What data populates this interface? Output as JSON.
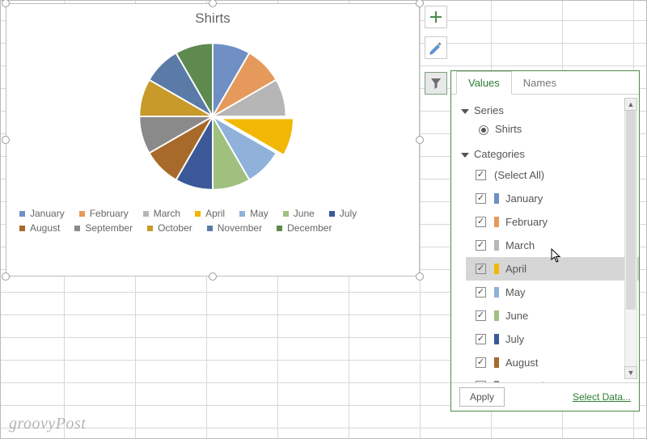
{
  "chart_data": {
    "type": "pie",
    "title": "Shirts",
    "series": [
      {
        "name": "Shirts",
        "categories": [
          "January",
          "February",
          "March",
          "April",
          "May",
          "June",
          "July",
          "August",
          "September",
          "October",
          "November",
          "December"
        ],
        "values": [
          8.3,
          8.3,
          8.3,
          8.3,
          8.3,
          8.3,
          8.3,
          8.3,
          8.3,
          8.3,
          8.3,
          8.3
        ]
      }
    ],
    "colors": {
      "January": "#6f8fc5",
      "February": "#e59a5b",
      "March": "#b6b6b6",
      "April": "#f2b705",
      "May": "#8fb1da",
      "June": "#a0c080",
      "July": "#3b5998",
      "August": "#a76a2a",
      "September": "#8a8a8a",
      "October": "#c79a2a",
      "November": "#5a7ba8",
      "December": "#5e8a4f"
    },
    "pulled_slice": "April"
  },
  "legend": [
    {
      "label": "January",
      "color": "#6f8fc5"
    },
    {
      "label": "February",
      "color": "#e59a5b"
    },
    {
      "label": "March",
      "color": "#b6b6b6"
    },
    {
      "label": "April",
      "color": "#f2b705"
    },
    {
      "label": "May",
      "color": "#8fb1da"
    },
    {
      "label": "June",
      "color": "#a0c080"
    },
    {
      "label": "July",
      "color": "#3b5998"
    },
    {
      "label": "August",
      "color": "#a76a2a"
    },
    {
      "label": "September",
      "color": "#8a8a8a"
    },
    {
      "label": "October",
      "color": "#c79a2a"
    },
    {
      "label": "November",
      "color": "#5a7ba8"
    },
    {
      "label": "December",
      "color": "#5e8a4f"
    }
  ],
  "filter_panel": {
    "tabs": {
      "values": "Values",
      "names": "Names"
    },
    "group_series": "Series",
    "series_option": "Shirts",
    "group_categories": "Categories",
    "select_all": "(Select All)",
    "visible_items": [
      {
        "label": "January",
        "color": "#6f8fc5"
      },
      {
        "label": "February",
        "color": "#e59a5b"
      },
      {
        "label": "March",
        "color": "#b6b6b6"
      },
      {
        "label": "April",
        "color": "#f2b705",
        "hover": true
      },
      {
        "label": "May",
        "color": "#8fb1da"
      },
      {
        "label": "June",
        "color": "#a0c080"
      },
      {
        "label": "July",
        "color": "#3b5998"
      },
      {
        "label": "August",
        "color": "#a76a2a"
      },
      {
        "label": "September",
        "color": "#8a8a8a"
      }
    ],
    "apply": "Apply",
    "select_data": "Select Data..."
  },
  "watermark": "groovyPost"
}
